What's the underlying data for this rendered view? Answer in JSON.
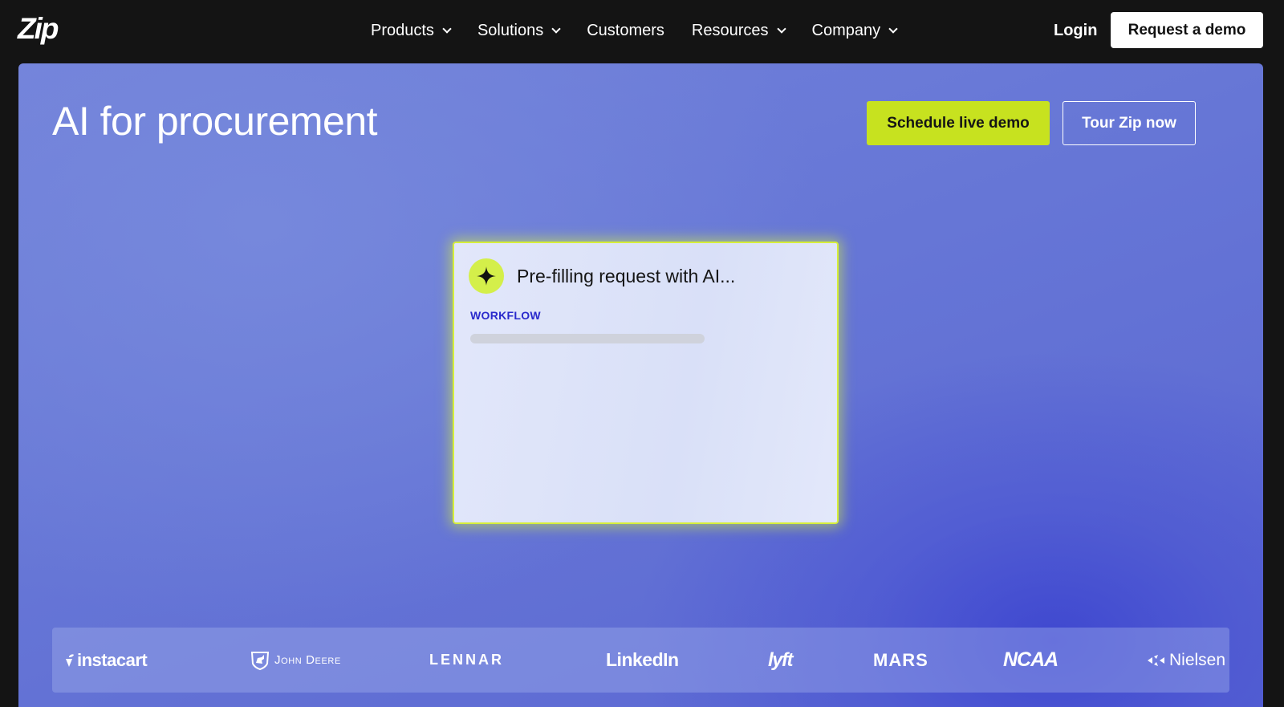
{
  "brand": {
    "name": "Zip"
  },
  "nav": {
    "items": [
      {
        "label": "Products",
        "has_dropdown": true
      },
      {
        "label": "Solutions",
        "has_dropdown": true
      },
      {
        "label": "Customers",
        "has_dropdown": false
      },
      {
        "label": "Resources",
        "has_dropdown": true
      },
      {
        "label": "Company",
        "has_dropdown": true
      }
    ],
    "login_label": "Login",
    "request_demo_label": "Request a demo"
  },
  "hero": {
    "title": "AI for procurement",
    "schedule_label": "Schedule live demo",
    "tour_label": "Tour Zip now",
    "colors": {
      "accent": "#c7e21f",
      "background": "#6a78d8",
      "deep": "#3f48d0"
    }
  },
  "card": {
    "icon": "sparkle-icon",
    "title": "Pre-filling request with AI...",
    "tag": "WORKFLOW"
  },
  "customer_logos": {
    "items": [
      "instacart",
      "John Deere",
      "LENNAR",
      "LinkedIn",
      "lyft",
      "MARS",
      "NCAA",
      "Nielsen"
    ]
  }
}
